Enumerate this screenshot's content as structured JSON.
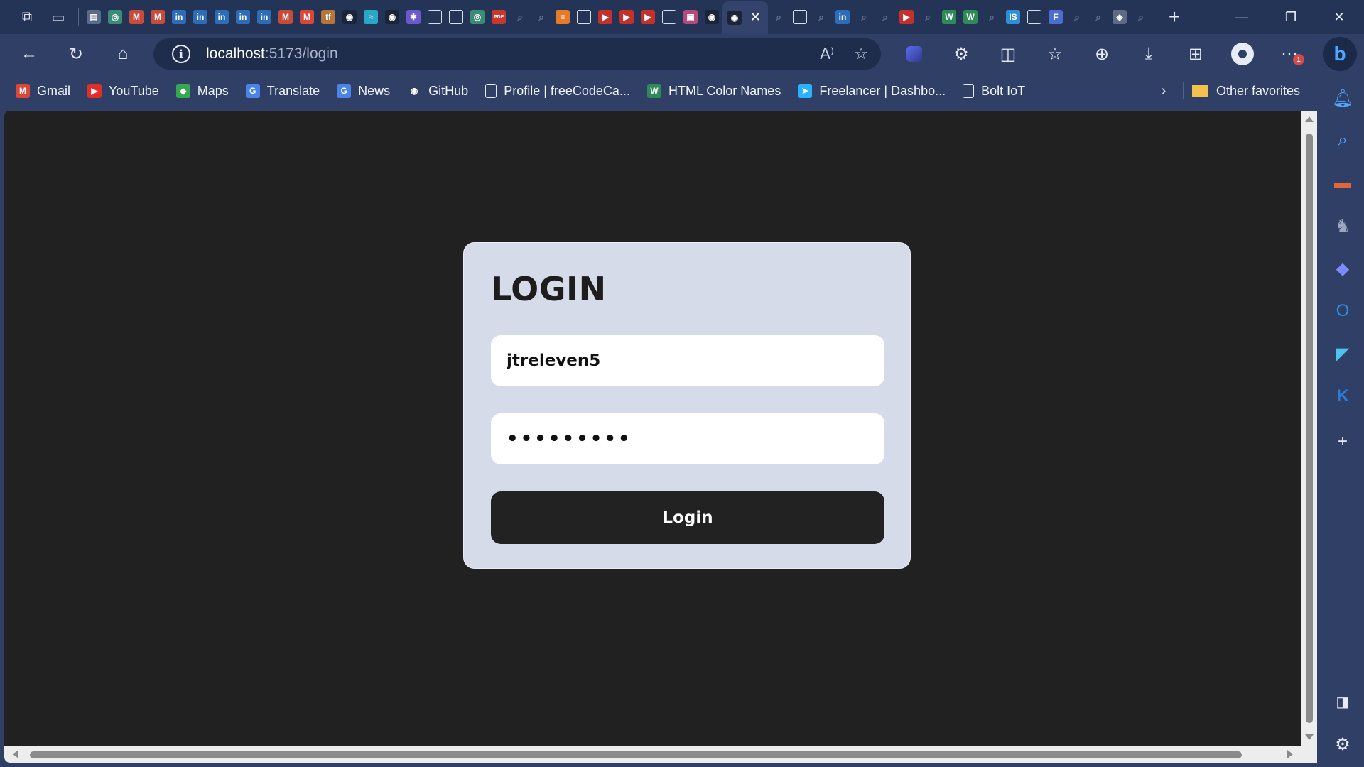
{
  "browser": {
    "tabs": [
      {
        "icon": "spreadsheet-icon",
        "color": "#5a6a8a",
        "glyph": "▤"
      },
      {
        "icon": "chatgpt-icon",
        "color": "#3c8b74",
        "glyph": "◎"
      },
      {
        "icon": "gmail-icon",
        "color": "#c74a3b",
        "glyph": "M"
      },
      {
        "icon": "gmail-icon",
        "color": "#c74a3b",
        "glyph": "M"
      },
      {
        "icon": "linkedin-icon",
        "color": "#2d6cb6",
        "glyph": "in"
      },
      {
        "icon": "linkedin-icon",
        "color": "#2d6cb6",
        "glyph": "in"
      },
      {
        "icon": "linkedin-icon",
        "color": "#2d6cb6",
        "glyph": "in"
      },
      {
        "icon": "linkedin-icon",
        "color": "#2d6cb6",
        "glyph": "in"
      },
      {
        "icon": "linkedin-icon",
        "color": "#2d6cb6",
        "glyph": "in"
      },
      {
        "icon": "gmail-icon",
        "color": "#c74a3b",
        "glyph": "M"
      },
      {
        "icon": "gmail-icon",
        "color": "#d9473a",
        "glyph": "M"
      },
      {
        "icon": "tensorflow-icon",
        "color": "#b7753a",
        "glyph": "tf"
      },
      {
        "icon": "github-icon",
        "color": "#1b2538",
        "glyph": "◉"
      },
      {
        "icon": "tailwind-icon",
        "color": "#2aa7c7",
        "glyph": "≈"
      },
      {
        "icon": "github-icon",
        "color": "#1b2538",
        "glyph": "◉"
      },
      {
        "icon": "figma-icon",
        "color": "#6a5acd",
        "glyph": "✱"
      },
      {
        "icon": "document-icon",
        "color": "outline",
        "glyph": ""
      },
      {
        "icon": "document-icon",
        "color": "outline",
        "glyph": ""
      },
      {
        "icon": "chatgpt-icon",
        "color": "#3c8b74",
        "glyph": "◎"
      },
      {
        "icon": "pdf-icon",
        "color": "#c9372c",
        "glyph": "PDF"
      },
      {
        "icon": "search-icon",
        "color": "dim",
        "glyph": "⌕"
      },
      {
        "icon": "search-icon",
        "color": "dim",
        "glyph": "⌕"
      },
      {
        "icon": "stackoverflow-icon",
        "color": "#e37b29",
        "glyph": "≡"
      },
      {
        "icon": "window-icon",
        "color": "outline",
        "glyph": ""
      },
      {
        "icon": "youtube-icon",
        "color": "#c4302b",
        "glyph": "▶"
      },
      {
        "icon": "youtube-icon",
        "color": "#c4302b",
        "glyph": "▶"
      },
      {
        "icon": "youtube-icon",
        "color": "#c4302b",
        "glyph": "▶"
      },
      {
        "icon": "document-icon",
        "color": "outline",
        "glyph": ""
      },
      {
        "icon": "app-icon",
        "color": "#b34a7a",
        "glyph": "▣"
      },
      {
        "icon": "github-icon",
        "color": "#1b2538",
        "glyph": "◉"
      }
    ],
    "tabs_after": [
      {
        "icon": "search-icon",
        "color": "dim",
        "glyph": "⌕"
      },
      {
        "icon": "document-icon",
        "color": "outline",
        "glyph": ""
      },
      {
        "icon": "search-icon",
        "color": "dim",
        "glyph": "⌕"
      },
      {
        "icon": "linkedin-icon",
        "color": "#2d6cb6",
        "glyph": "in"
      },
      {
        "icon": "search-icon",
        "color": "dim",
        "glyph": "⌕"
      },
      {
        "icon": "search-icon",
        "color": "dim",
        "glyph": "⌕"
      },
      {
        "icon": "youtube-icon",
        "color": "#c4302b",
        "glyph": "▶"
      },
      {
        "icon": "search-icon",
        "color": "dim",
        "glyph": "⌕"
      },
      {
        "icon": "w3-icon",
        "color": "#2e8b57",
        "glyph": "W"
      },
      {
        "icon": "w3-icon",
        "color": "#2e8b57",
        "glyph": "W"
      },
      {
        "icon": "search-icon",
        "color": "dim",
        "glyph": "⌕"
      },
      {
        "icon": "app-icon",
        "color": "#2f8fd6",
        "glyph": "IS"
      },
      {
        "icon": "window-icon",
        "color": "outline",
        "glyph": ""
      },
      {
        "icon": "forms-icon",
        "color": "#4a6ed1",
        "glyph": "F"
      },
      {
        "icon": "search-icon",
        "color": "dim",
        "glyph": "⌕"
      },
      {
        "icon": "search-icon",
        "color": "dim",
        "glyph": "⌕"
      },
      {
        "icon": "app-icon",
        "color": "#5e6b84",
        "glyph": "◈"
      },
      {
        "icon": "search-icon",
        "color": "dim",
        "glyph": "⌕"
      }
    ],
    "active_tab": {
      "icon": "github-icon",
      "glyph": "◉",
      "close": "✕"
    }
  },
  "address": {
    "host": "localhost",
    "path": ":5173/login"
  },
  "bookmarks": [
    {
      "label": "Gmail",
      "icon": "gmail-icon",
      "color": "#d9473a",
      "glyph": "M"
    },
    {
      "label": "YouTube",
      "icon": "youtube-icon",
      "color": "#e52d27",
      "glyph": "▶"
    },
    {
      "label": "Maps",
      "icon": "maps-icon",
      "color": "#34a853",
      "glyph": "◆"
    },
    {
      "label": "Translate",
      "icon": "translate-icon",
      "color": "#4a84e8",
      "glyph": "G"
    },
    {
      "label": "News",
      "icon": "news-icon",
      "color": "#4a84e8",
      "glyph": "G"
    },
    {
      "label": "GitHub",
      "icon": "github-icon",
      "color": "#2f3f66",
      "glyph": "◉"
    },
    {
      "label": "Profile | freeCodeCa...",
      "icon": "document-icon",
      "color": "outline",
      "glyph": ""
    },
    {
      "label": "HTML Color Names",
      "icon": "w3-icon",
      "color": "#2e8b57",
      "glyph": "W"
    },
    {
      "label": "Freelancer | Dashbo...",
      "icon": "freelancer-icon",
      "color": "#29b2fe",
      "glyph": "➤"
    },
    {
      "label": "Bolt IoT",
      "icon": "document-icon",
      "color": "outline",
      "glyph": ""
    }
  ],
  "other_favorites": "Other favorites",
  "page": {
    "title": "LOGIN",
    "username_value": "jtreleven5",
    "password_value": "•••••••••",
    "login_button": "Login"
  },
  "notification_badge": "1"
}
